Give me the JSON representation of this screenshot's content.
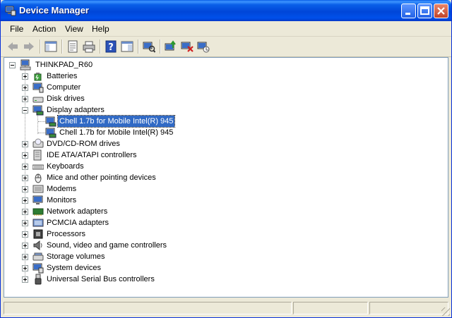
{
  "window": {
    "title": "Device Manager"
  },
  "menu": {
    "items": [
      "File",
      "Action",
      "View",
      "Help"
    ]
  },
  "toolbar": {
    "buttons": [
      "back-icon",
      "forward-icon",
      "console-tree-icon",
      "properties-icon",
      "print-icon",
      "help-icon",
      "details-pane-icon",
      "scan-hardware-icon",
      "update-driver-icon",
      "uninstall-icon",
      "disable-icon"
    ]
  },
  "tree": {
    "root": "THINKPAD_R60",
    "categories": [
      "Batteries",
      "Computer",
      "Disk drives",
      "Display adapters",
      "DVD/CD-ROM drives",
      "IDE ATA/ATAPI controllers",
      "Keyboards",
      "Mice and other pointing devices",
      "Modems",
      "Monitors",
      "Network adapters",
      "PCMCIA adapters",
      "Processors",
      "Sound, video and game controllers",
      "Storage volumes",
      "System devices",
      "Universal Serial Bus controllers"
    ],
    "display_children": [
      "Chell 1.7b for Mobile Intel(R) 945",
      "Chell 1.7b for Mobile Intel(R) 945"
    ]
  },
  "colors": {
    "titlebar": "#0a5fe8",
    "selection": "#316ac5"
  }
}
